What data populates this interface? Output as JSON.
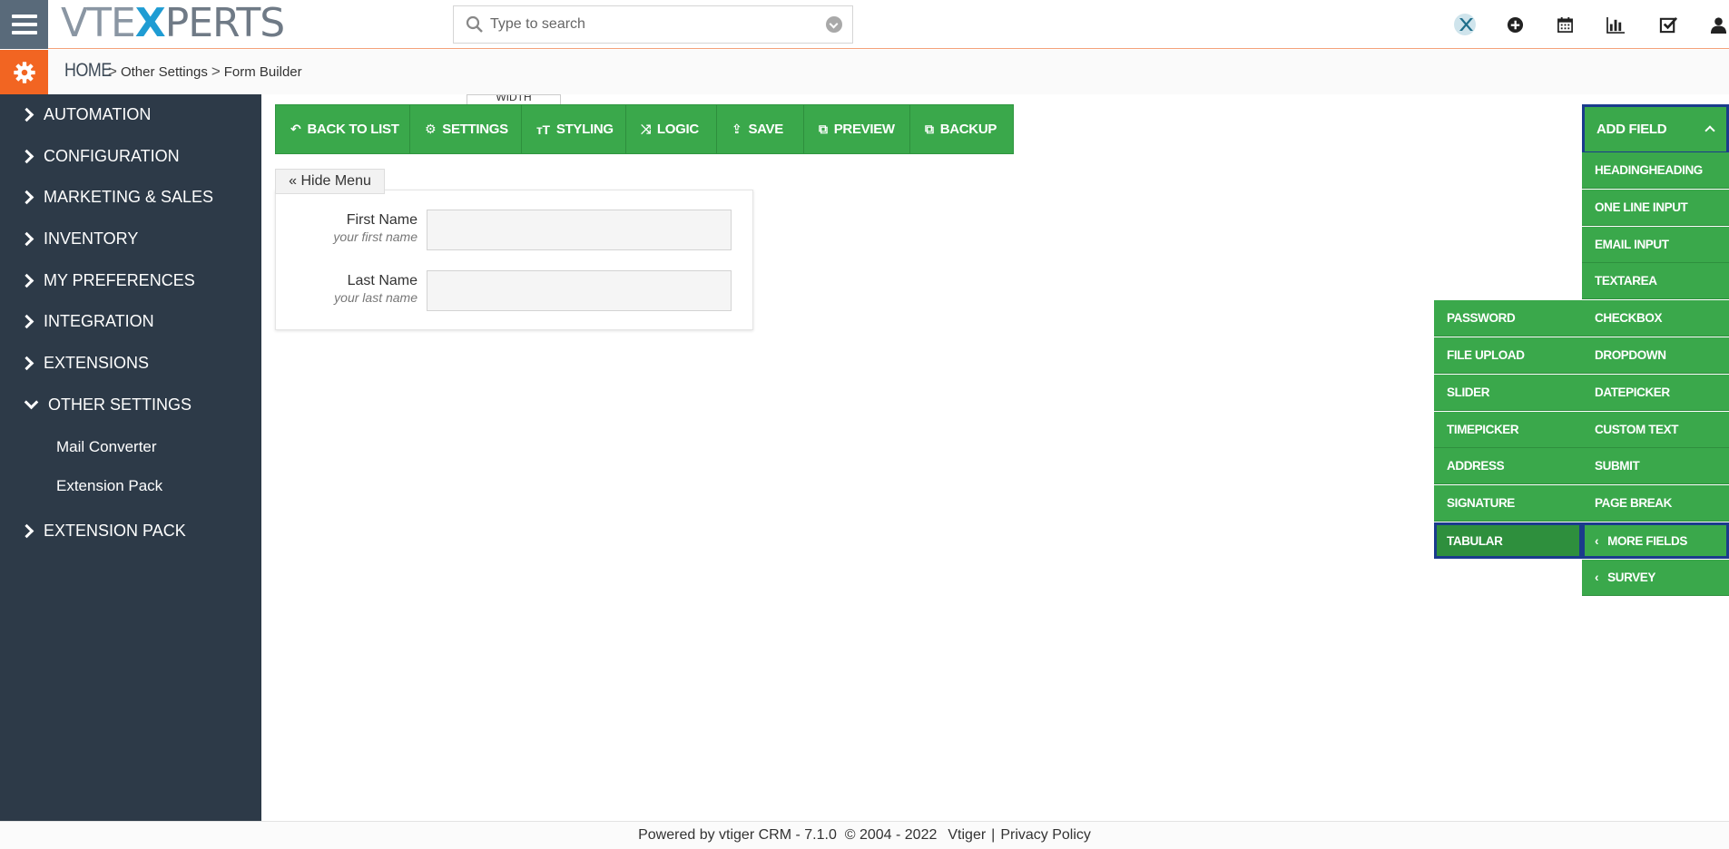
{
  "logo": {
    "vt": "VTE",
    "x": "X",
    "perts": "PERTS"
  },
  "search": {
    "placeholder": "Type to search"
  },
  "breadcrumb": {
    "home": "HOME",
    "sep1": ">",
    "level1": "Other Settings",
    "sep2": ">",
    "level2": "Form Builder"
  },
  "sidebar": {
    "items": [
      {
        "label": "AUTOMATION"
      },
      {
        "label": "CONFIGURATION"
      },
      {
        "label": "MARKETING & SALES"
      },
      {
        "label": "INVENTORY"
      },
      {
        "label": "MY PREFERENCES"
      },
      {
        "label": "INTEGRATION"
      },
      {
        "label": "EXTENSIONS"
      },
      {
        "label": "OTHER SETTINGS"
      },
      {
        "label": "EXTENSION PACK"
      }
    ],
    "sub_items": [
      {
        "label": "Mail Converter"
      },
      {
        "label": "Extension Pack"
      }
    ]
  },
  "toolbar": {
    "width_tab": "WIDTH",
    "back": "BACK TO LIST",
    "settings": "SETTINGS",
    "styling": "STYLING",
    "logic": "LOGIC",
    "save": "SAVE",
    "preview": "PREVIEW",
    "backup": "BACKUP"
  },
  "form": {
    "hide_menu": "« Hide Menu",
    "first_name_label": "First Name",
    "first_name_sub": "your first name",
    "last_name_label": "Last Name",
    "last_name_sub": "your last name"
  },
  "add_field": {
    "title": "ADD FIELD",
    "fields": [
      "HEADINGHEADING",
      "ONE LINE INPUT",
      "EMAIL INPUT",
      "TEXTAREA",
      "CHECKBOX",
      "DROPDOWN",
      "DATEPICKER",
      "CUSTOM TEXT",
      "SUBMIT",
      "PAGE BREAK",
      "MORE FIELDS",
      "SURVEY"
    ],
    "more_fields": [
      "PASSWORD",
      "FILE UPLOAD",
      "SLIDER",
      "TIMEPICKER",
      "ADDRESS",
      "SIGNATURE",
      "TABULAR"
    ]
  },
  "footer": {
    "powered": "Powered by vtiger CRM - 7.1.0  © 2004 - 2022",
    "vtiger": "Vtiger",
    "sep": "|",
    "privacy": "Privacy Policy"
  },
  "colors": {
    "accent_green": "#3aa84b",
    "sidebar_bg": "#2d3a48",
    "gear_orange": "#f26522",
    "selection_border": "#1a3b8c"
  }
}
